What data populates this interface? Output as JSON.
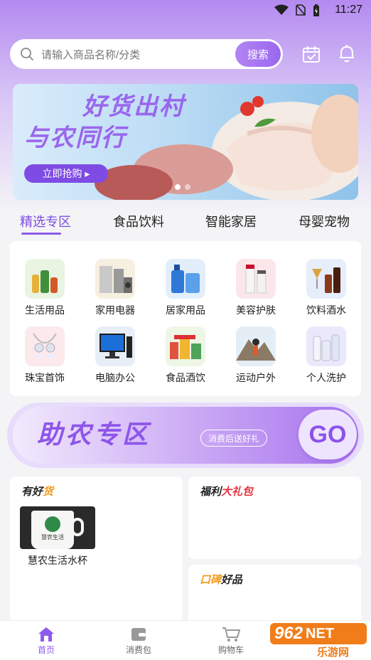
{
  "status_bar": {
    "time": "11:27"
  },
  "search": {
    "placeholder": "请输入商品名称/分类",
    "button": "搜索"
  },
  "banner": {
    "line1": "好货出村",
    "line2": "与农同行",
    "cta": "立即抢购 ▸"
  },
  "category_tabs": [
    {
      "label": "精选专区",
      "active": true
    },
    {
      "label": "食品饮料",
      "active": false
    },
    {
      "label": "智能家居",
      "active": false
    },
    {
      "label": "母婴宠物",
      "active": false
    }
  ],
  "categories": [
    {
      "label": "生活用品",
      "icon": "daily-goods-icon",
      "color": "#e9f4e3"
    },
    {
      "label": "家用电器",
      "icon": "appliance-icon",
      "color": "#f7efe0"
    },
    {
      "label": "居家用品",
      "icon": "home-goods-icon",
      "color": "#e2effb"
    },
    {
      "label": "美容护肤",
      "icon": "skincare-icon",
      "color": "#fbe7ea"
    },
    {
      "label": "饮料酒水",
      "icon": "drinks-icon",
      "color": "#e6eefb"
    },
    {
      "label": "珠宝首饰",
      "icon": "jewelry-icon",
      "color": "#fbe9ec"
    },
    {
      "label": "电脑办公",
      "icon": "computer-icon",
      "color": "#e7eef8"
    },
    {
      "label": "食品酒饮",
      "icon": "food-icon",
      "color": "#eef6e6"
    },
    {
      "label": "运动户外",
      "icon": "outdoor-icon",
      "color": "#e6eef5"
    },
    {
      "label": "个人洗护",
      "icon": "personal-care-icon",
      "color": "#ece8fb"
    }
  ],
  "promo": {
    "title": "助农专区",
    "pill": "消费后送好礼",
    "go": "GO"
  },
  "sections": {
    "good_goods": {
      "title_a": "有好",
      "title_b": "货",
      "product": "慧农生活水杯",
      "cup_text": "慧农生活"
    },
    "gift_pack": {
      "title_a": "福利",
      "title_b": "大礼包"
    },
    "reputation": {
      "title_a": "口碑",
      "title_b": "好品"
    }
  },
  "bottom_nav": [
    {
      "label": "首页",
      "icon": "home-icon",
      "active": true
    },
    {
      "label": "消费包",
      "icon": "wallet-icon",
      "active": false
    },
    {
      "label": "购物车",
      "icon": "cart-icon",
      "active": false
    }
  ],
  "watermark": {
    "brand": "962",
    "suffix": "NET",
    "sub": "乐游网"
  },
  "colors": {
    "accent": "#8e5aec",
    "accent_light": "#b48af0"
  }
}
